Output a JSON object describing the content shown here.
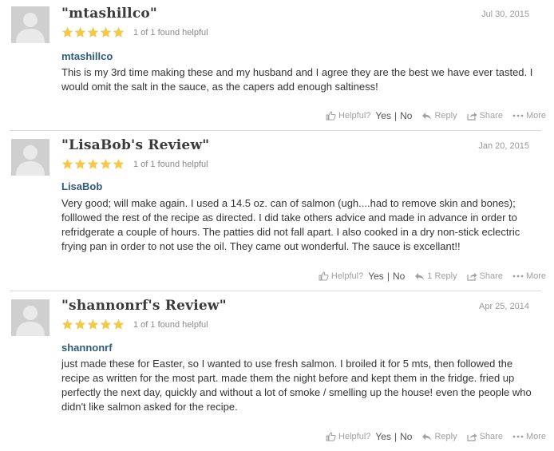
{
  "reviews": [
    {
      "title": "\"mtashillco\"",
      "date": "Jul 30, 2015",
      "rating": 5,
      "helpful_count": "1 of 1 found helpful",
      "author": "mtashillco",
      "body": "This is my 3rd time making these and my husband and I agree they are the best we have ever tasted.  I would omit the salt in the sauce, as the capers add enough saltiness!",
      "helpful_label": "Helpful?",
      "yes_label": "Yes",
      "no_label": "No",
      "reply_label": "Reply",
      "share_label": "Share",
      "more_label": "More"
    },
    {
      "title": "\"LisaBob's Review\"",
      "date": "Jan 20, 2015",
      "rating": 5,
      "helpful_count": "1 of 1 found helpful",
      "author": "LisaBob",
      "body": "Very good; will make again. I used a 14.5 oz. can of salmon (ugh....had to remove skin and bones); folllowed the rest of the recipe as directed. I did take others advice and made in advance in order to refridgerate a couple of hours. The patties did not fall apart. I also cooked in a dry non-stick eclectric frying pan in order to not use the oil. They came out wonderful. The sauce is excellant!!",
      "helpful_label": "Helpful?",
      "yes_label": "Yes",
      "no_label": "No",
      "reply_label": "1 Reply",
      "share_label": "Share",
      "more_label": "More"
    },
    {
      "title": "\"shannonrf's Review\"",
      "date": "Apr 25, 2014",
      "rating": 5,
      "helpful_count": "1 of 1 found helpful",
      "author": "shannonrf",
      "body": "just made these for Easter, so I wanted to use fresh salmon. I broiled it for 5 mts, then followed the recipe as written for the most part. made them the night before and kept them in the fridge. fried up perfectly the next day, quickly and without a lot of smoke / smelling up the house! even the people who didn't like salmon asked for the recipe.",
      "helpful_label": "Helpful?",
      "yes_label": "Yes",
      "no_label": "No",
      "reply_label": "Reply",
      "share_label": "Share",
      "more_label": "More"
    }
  ],
  "colors": {
    "star": "#f5c84a",
    "author": "#2e5c7e",
    "muted": "#a0a0a0",
    "avatar_bg": "#cfcfcf",
    "avatar_fg": "#e9e9e9"
  },
  "icons": {
    "avatar": "person-silhouette-icon",
    "helpful": "thumbs-up-icon",
    "reply": "reply-arrow-icon",
    "share": "share-icon",
    "more": "more-dots-icon"
  }
}
